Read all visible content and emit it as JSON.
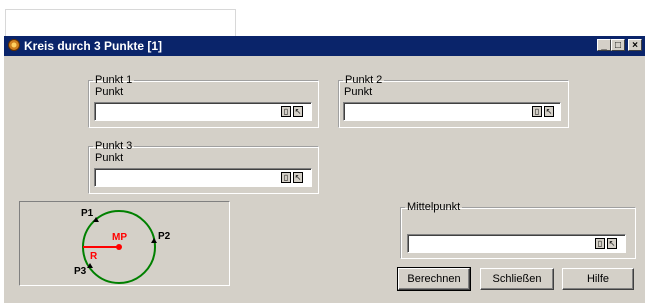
{
  "window": {
    "title": "Kreis durch 3 Punkte [1]"
  },
  "title_buttons": {
    "minimize": "_",
    "maximize": "□",
    "close": "×"
  },
  "groups": {
    "p1": {
      "legend": "Punkt 1",
      "label": "Punkt",
      "value": ""
    },
    "p2": {
      "legend": "Punkt 2",
      "label": "Punkt",
      "value": ""
    },
    "p3": {
      "legend": "Punkt 3",
      "label": "Punkt",
      "value": ""
    },
    "center": {
      "legend": "Mittelpunkt",
      "value": ""
    }
  },
  "buttons": {
    "calculate": "Berechnen",
    "close": "Schließen",
    "help": "Hilfe"
  },
  "diagram": {
    "p1": "P1",
    "p2": "P2",
    "p3": "P3",
    "mp": "MP",
    "r": "R",
    "circle_color": "#008000",
    "accent_color": "#ff0000"
  },
  "colors": {
    "titlebar": "#0a246a",
    "face": "#d4d0c8"
  }
}
